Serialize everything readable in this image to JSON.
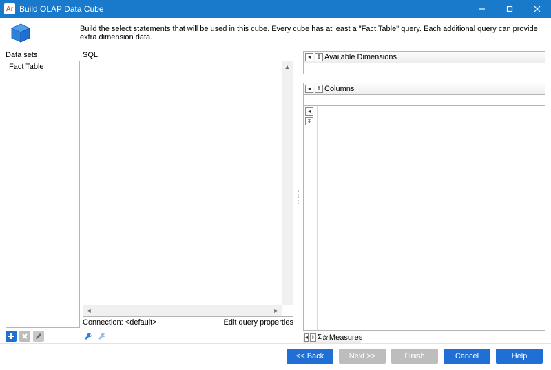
{
  "window": {
    "title": "Build OLAP Data Cube",
    "app_badge": "Ar"
  },
  "header": {
    "description": "Build the select statements that will be used in this cube.  Every cube has at least a \"Fact Table\" query.  Each additional query can provide extra dimension data."
  },
  "datasets": {
    "label": "Data sets",
    "items": [
      "Fact Table"
    ]
  },
  "sql": {
    "label": "SQL",
    "value": "",
    "connection_label": "Connection:",
    "connection_value": "<default>",
    "edit_link": "Edit query properties"
  },
  "right": {
    "available_dimensions": "Available Dimensions",
    "columns": "Columns",
    "measures": "Measures"
  },
  "footer": {
    "back": "<< Back",
    "next": "Next >>",
    "finish": "Finish",
    "cancel": "Cancel",
    "help": "Help"
  }
}
